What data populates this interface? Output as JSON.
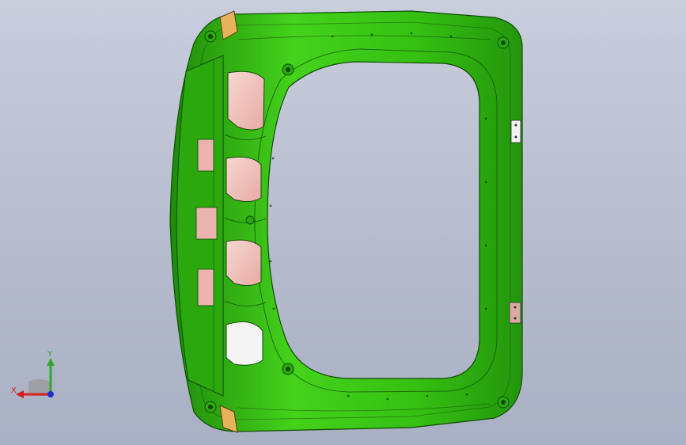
{
  "viewport": {
    "background_top": "#c9cedd",
    "background_bottom": "#a9b0c3"
  },
  "model": {
    "part_color": "#35c012",
    "part_dark": "#1f8a0a",
    "part_edge": "#0e4a06",
    "opening_color": "#f1c7c3",
    "bracket_color": "#d9a9a2"
  },
  "triad": {
    "x_label": "X",
    "y_label": "Y",
    "x_color": "#d62020",
    "y_color": "#2ea82e",
    "z_color": "#2030d0"
  }
}
